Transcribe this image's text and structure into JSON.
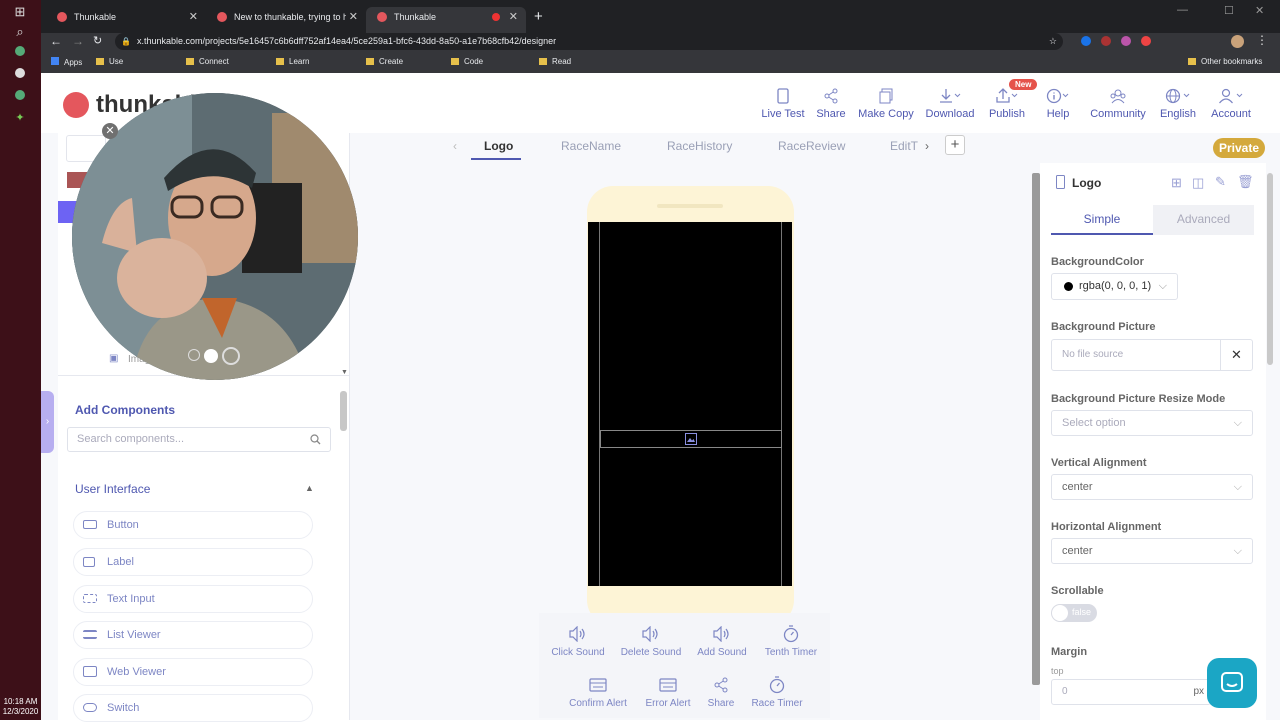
{
  "browser": {
    "tabs": [
      {
        "title": "Thunkable"
      },
      {
        "title": "New to thunkable, trying to hire"
      },
      {
        "title": "Thunkable"
      }
    ],
    "url": "x.thunkable.com/projects/5e16457c6b6dff752af14ea4/5ce259a1-bfc6-43dd-8a50-a1e7b68cfb42/designer",
    "bookmarks": [
      "Apps",
      "Use",
      "Connect",
      "Learn",
      "Create",
      "Code",
      "Read"
    ],
    "other_bookmarks": "Other bookmarks"
  },
  "taskbar": {
    "time": "10:18 AM",
    "date": "12/3/2020"
  },
  "header": {
    "logo": "thunkable",
    "buttons": [
      {
        "label": "Live Test"
      },
      {
        "label": "Share"
      },
      {
        "label": "Make Copy"
      },
      {
        "label": "Download"
      },
      {
        "label": "Publish"
      },
      {
        "label": "Help"
      },
      {
        "label": "Community"
      },
      {
        "label": "English"
      },
      {
        "label": "Account"
      }
    ],
    "new_badge": "New"
  },
  "screen_tabs": [
    "Logo",
    "RaceName",
    "RaceHistory",
    "RaceReview",
    "EditT"
  ],
  "private_label": "Private",
  "tree": {
    "partial_item": "Imag"
  },
  "left_panel": {
    "add_components": "Add Components",
    "search_placeholder": "Search components...",
    "section": "User Interface",
    "components": [
      "Button",
      "Label",
      "Text Input",
      "List Viewer",
      "Web Viewer",
      "Switch"
    ]
  },
  "actions": [
    {
      "label": "Click Sound",
      "icon": "speaker-icon"
    },
    {
      "label": "Delete Sound",
      "icon": "speaker-icon"
    },
    {
      "label": "Add Sound",
      "icon": "speaker-icon"
    },
    {
      "label": "Tenth Timer",
      "icon": "stopwatch-icon"
    },
    {
      "label": "Confirm Alert",
      "icon": "alert-icon"
    },
    {
      "label": "Error Alert",
      "icon": "alert-icon"
    },
    {
      "label": "Share",
      "icon": "share-icon"
    },
    {
      "label": "Race Timer",
      "icon": "stopwatch-icon"
    }
  ],
  "properties": {
    "title": "Logo",
    "tabs": [
      "Simple",
      "Advanced"
    ],
    "background_color_label": "BackgroundColor",
    "background_color_value": "rgba(0, 0, 0, 1)",
    "background_picture_label": "Background Picture",
    "background_picture_placeholder": "No file source",
    "resize_mode_label": "Background Picture Resize Mode",
    "resize_mode_placeholder": "Select option",
    "vertical_alignment_label": "Vertical Alignment",
    "vertical_alignment_value": "center",
    "horizontal_alignment_label": "Horizontal Alignment",
    "horizontal_alignment_value": "center",
    "scrollable_label": "Scrollable",
    "scrollable_value": "false",
    "margin_label": "Margin",
    "margin_top_label": "top",
    "margin_top_value": "0",
    "margin_unit": "px"
  },
  "colors": {
    "accent": "#4f58b0",
    "brand_red": "#e4575d",
    "private": "#d4a93c",
    "chat": "#1ba6c5"
  }
}
